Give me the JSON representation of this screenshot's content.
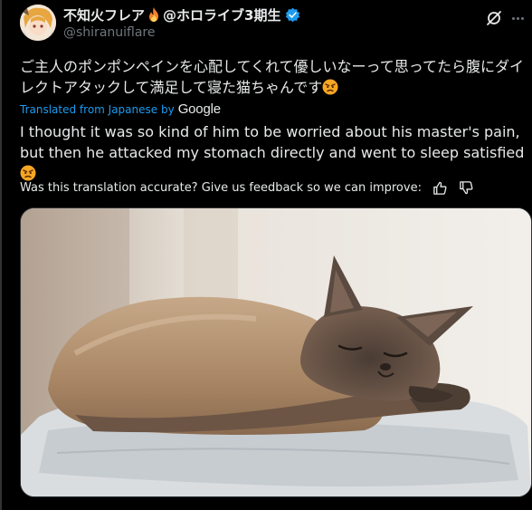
{
  "author": {
    "display_name": "不知火フレア",
    "flame_icon": "fire-emoji",
    "display_name_suffix": "@ホロライブ3期生",
    "handle": "@shiranuiflare",
    "verified_color": "#1d9bf0"
  },
  "tweet": {
    "original_text": "ご主人のポンポンペインを心配してくれて優しいなーって思ってたら腹にダイレクトアタックして満足して寝た猫ちゃんです",
    "emoji": "angry-face",
    "translated_by_label": "Translated from Japanese by",
    "translator_brand": "Google",
    "translated_text": "I thought it was so kind of him to be worried about his master's pain, but then he attacked my stomach directly and went to sleep satisfied",
    "feedback_prompt": "Was this translation accurate? Give us feedback so we can improve:"
  },
  "media": {
    "description_icon": "sleeping-cat-photo"
  },
  "colors": {
    "background": "#000000",
    "text": "#e7e9ea",
    "secondary": "#71767b",
    "accent": "#1d9bf0"
  }
}
